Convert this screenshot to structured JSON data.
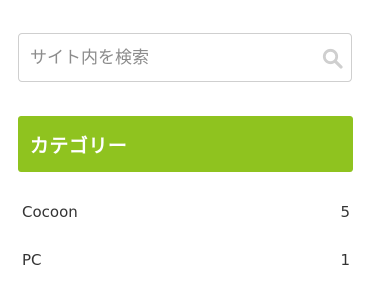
{
  "search": {
    "placeholder": "サイト内を検索",
    "value": "",
    "icon": "search-icon"
  },
  "category_widget": {
    "title": "カテゴリー",
    "header_color": "#8fc31f",
    "items": [
      {
        "label": "Cocoon",
        "count": "5"
      },
      {
        "label": "PC",
        "count": "1"
      }
    ]
  }
}
